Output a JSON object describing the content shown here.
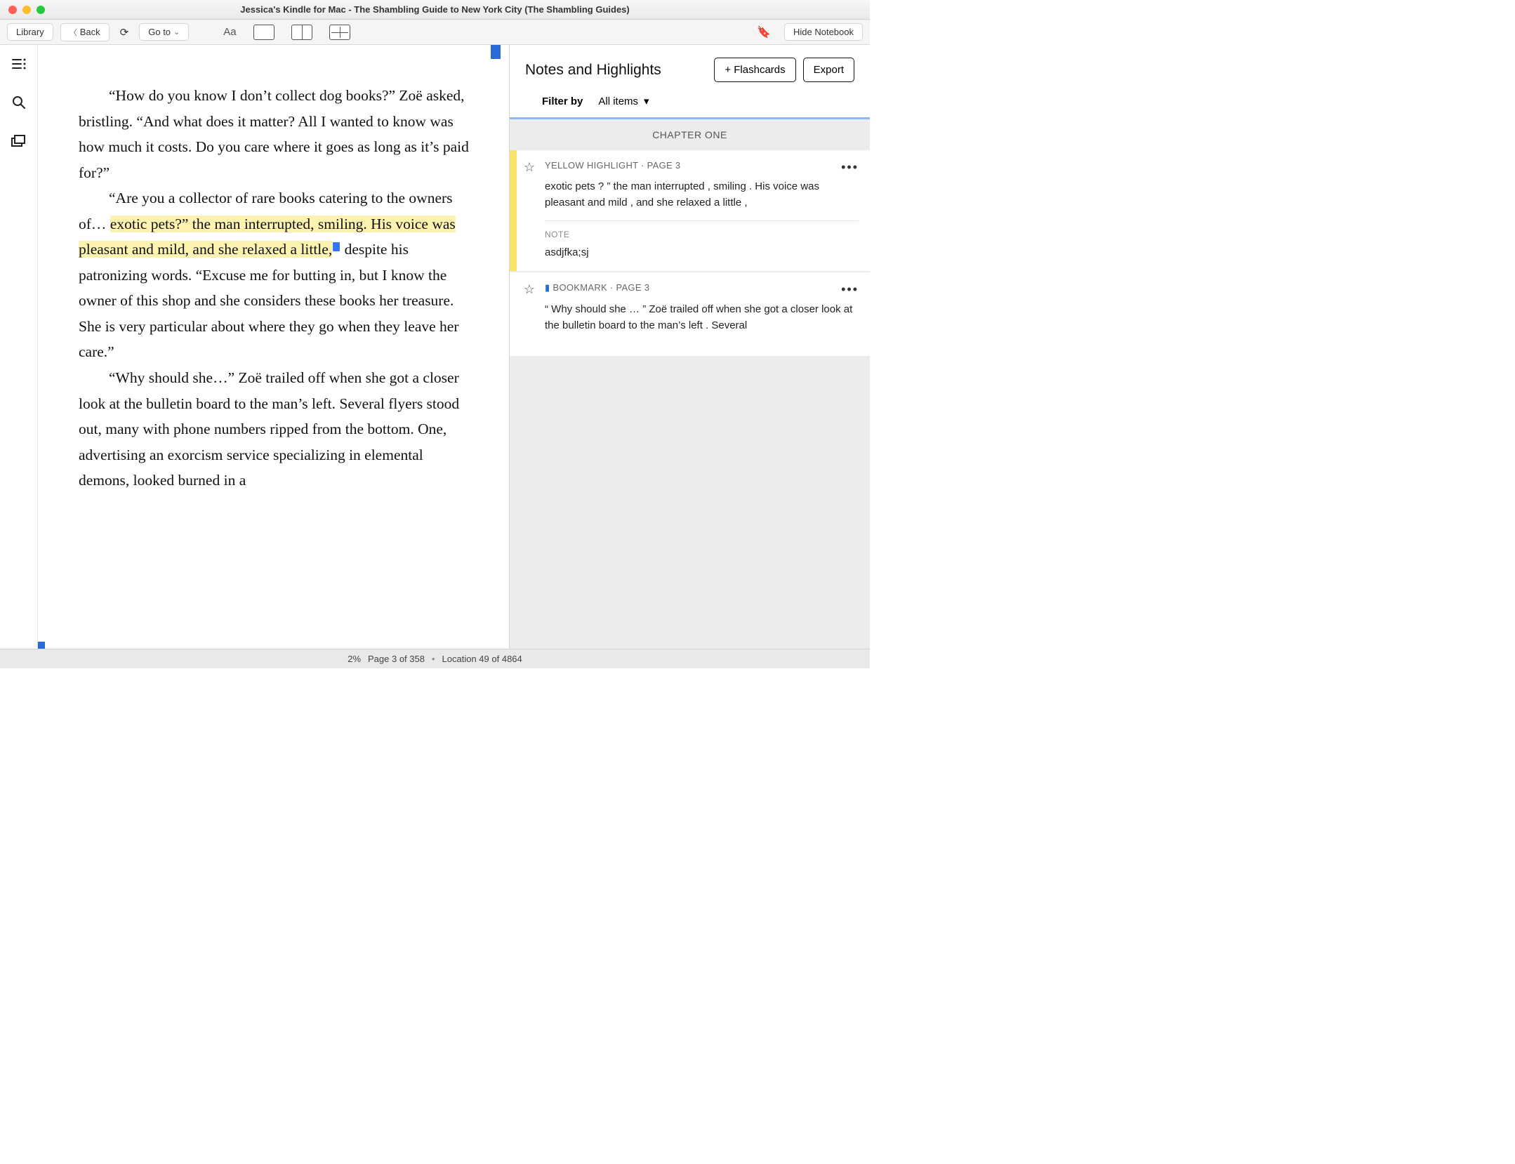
{
  "window": {
    "title": "Jessica's Kindle for Mac - The Shambling Guide to New York City (The Shambling Guides)"
  },
  "toolbar": {
    "library": "Library",
    "back": "Back",
    "goto": "Go to",
    "hide_notebook": "Hide Notebook"
  },
  "reader": {
    "p1_pre": "“How do you know I don’t collect dog books?” Zoë asked, bristling. “And what does it matter? All I wanted to know was how much it costs. Do you care where it goes as long as it’s paid for?”",
    "p2_pre": "“Are you a collector of rare books catering to the owners of… ",
    "p2_hl": "exotic pets?” the man interrupted, smiling. His voice was pleasant and mild, and she relaxed a little,",
    "p2_post": " despite his patronizing words. “Excuse me for butting in, but I know the owner of this shop and she considers these books her treasure. She is very particular about where they go when they leave her care.”",
    "p3": "“Why should she…” Zoë trailed off when she got a closer look at the bulletin board to the man’s left. Several flyers stood out, many with phone numbers ripped from the bottom. One, advertising an exorcism service specializing in elemental demons, looked burned in a"
  },
  "notebook": {
    "title": "Notes and Highlights",
    "flashcards_btn": "+ Flashcards",
    "export_btn": "Export",
    "filter_label": "Filter by",
    "filter_value": "All items",
    "chapter": "CHAPTER ONE",
    "items": [
      {
        "kind": "YELLOW HIGHLIGHT · PAGE 3",
        "excerpt": "exotic pets ? ” the man interrupted , smiling . His voice was pleasant and mild , and she relaxed a little ,",
        "note_label": "NOTE",
        "note_text": "asdjfka;sj"
      },
      {
        "kind": "BOOKMARK · PAGE 3",
        "excerpt": "“ Why should she … ” Zoë trailed off when she got a closer look at the bulletin board to the man’s left . Several"
      }
    ]
  },
  "status": {
    "percent": "2%",
    "page": "Page 3 of 358",
    "location": "Location 49 of 4864"
  }
}
